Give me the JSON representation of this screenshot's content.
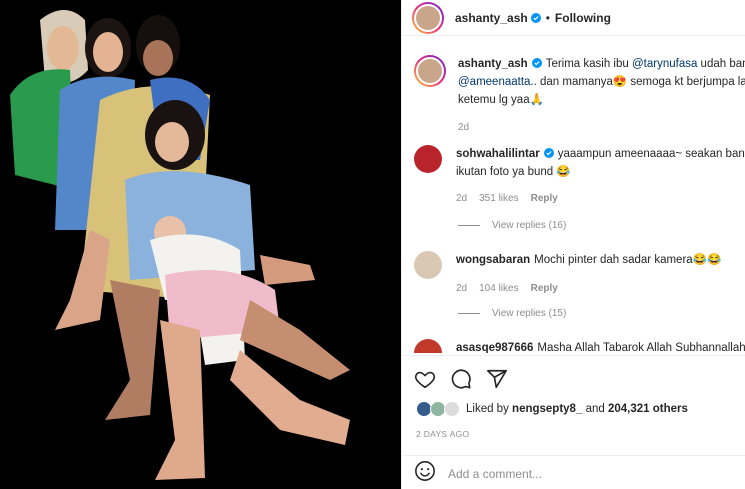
{
  "post": {
    "username": "ashanty_ash",
    "follow_status": "Following",
    "image_alt": "Family photo"
  },
  "comments": [
    {
      "username": "ashanty_ash",
      "verified": true,
      "parts": [
        "Terima kasih ibu ",
        "@tarynufasa",
        " udah bantu",
        "@ameenaatta",
        ".. dan mamanya😍 semoga kt berjumpa lag",
        "ketemu lg yaa🙏"
      ],
      "age": "2d"
    },
    {
      "username": "sohwahalilintar",
      "verified": true,
      "text_line1": "yaaampun ameenaaaa~ seakan bang a",
      "text_line2": "ikutan foto ya bund 😂",
      "age": "2d",
      "likes": "351 likes",
      "reply": "Reply",
      "view_replies": "View replies (16)"
    },
    {
      "username": "wongsabaran",
      "text": "Mochi pinter dah sadar kamera😂😂",
      "age": "2d",
      "likes": "104 likes",
      "reply": "Reply",
      "view_replies": "View replies (15)"
    },
    {
      "username": "asasqe987666",
      "text": "Masha Allah Tabarok Allah Subhannallah"
    }
  ],
  "actions": {
    "liked_by_prefix": "Liked by",
    "liked_by_user": "nengsepty8_",
    "and": "and",
    "others": "204,321 others",
    "date": "2 DAYS AGO",
    "comment_placeholder": "Add a comment..."
  },
  "icons": [
    "heart-icon",
    "comment-icon",
    "share-icon",
    "emoji-icon",
    "verified-icon"
  ],
  "colors": {
    "verified": "#0095f6",
    "mention": "#00376b",
    "muted": "#8e8e8e"
  }
}
